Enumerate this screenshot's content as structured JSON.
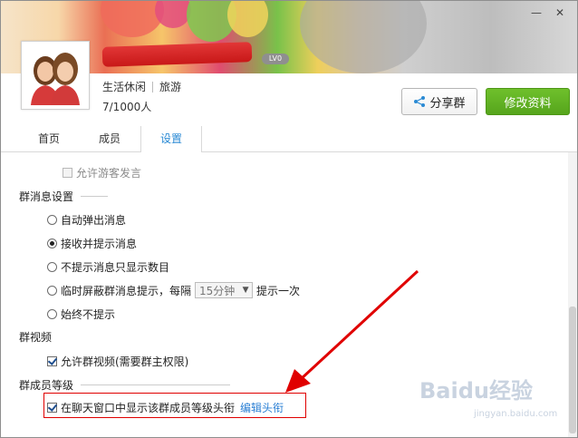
{
  "window": {
    "minimize_icon": "minimize-icon",
    "close_icon": "close-icon"
  },
  "header": {
    "level_badge": "LV0",
    "tags": [
      "生活休闲",
      "旅游"
    ],
    "member_count": "7/1000人",
    "share_button": "分享群",
    "edit_button": "修改资料",
    "share_icon": "share-icon",
    "brand_color": "#5cae1f"
  },
  "tabs": [
    {
      "label": "首页"
    },
    {
      "label": "成员"
    },
    {
      "label": "设置",
      "active": true
    }
  ],
  "settings": {
    "guest_speech": {
      "label": "允许游客发言",
      "checked": false,
      "disabled": true
    },
    "group_message": {
      "title": "群消息设置",
      "options": [
        {
          "label": "自动弹出消息",
          "checked": false
        },
        {
          "label": "接收并提示消息",
          "checked": true
        },
        {
          "label": "不提示消息只显示数目",
          "checked": false
        },
        {
          "label_before": "临时屏蔽群消息提示，",
          "label_every": "每隔",
          "select_value": "15分钟",
          "label_after": "提示一次",
          "checked": false
        },
        {
          "label": "始终不提示",
          "checked": false
        }
      ]
    },
    "group_video": {
      "title": "群视频",
      "option": {
        "label": "允许群视频(需要群主权限)",
        "checked": true
      }
    },
    "member_level": {
      "title": "群成员等级",
      "option": {
        "label": "在聊天窗口中显示该群成员等级头衔",
        "checked": true
      },
      "link": "编辑头衔"
    }
  },
  "watermark": {
    "main": "Baidu经验",
    "sub": "jingyan.baidu.com"
  }
}
